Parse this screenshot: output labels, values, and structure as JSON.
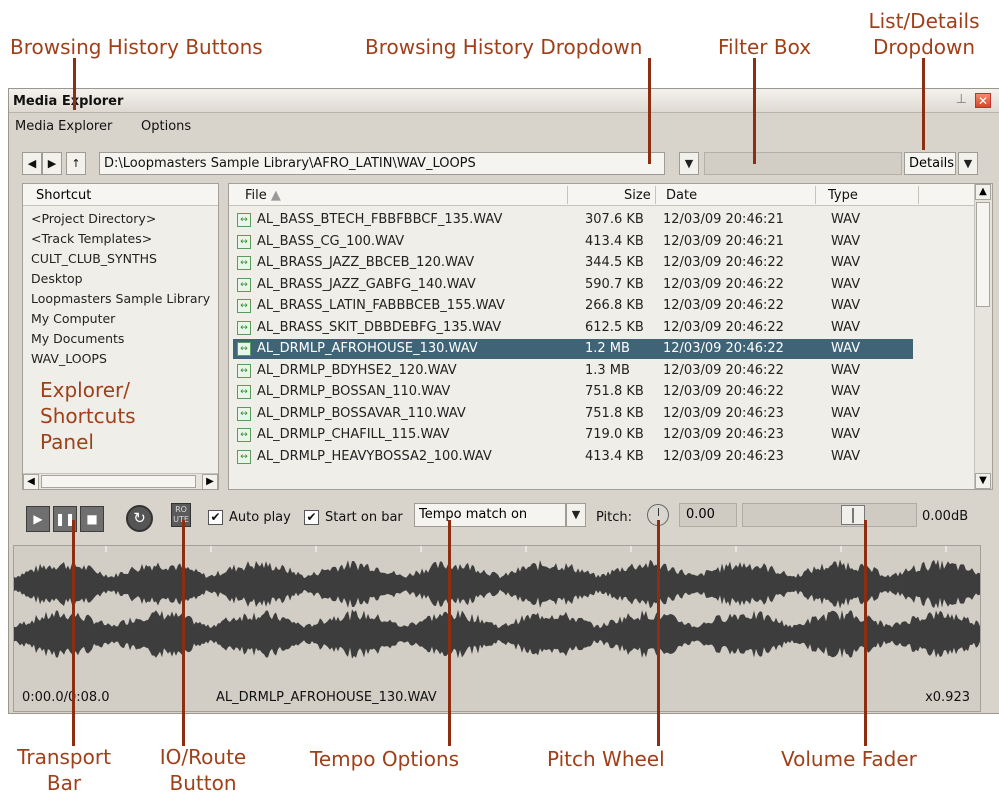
{
  "callouts": {
    "history_buttons": "Browsing History Buttons",
    "history_dropdown": "Browsing History Dropdown",
    "filter_box": "Filter Box",
    "list_details_1": "List/Details",
    "list_details_2": "Dropdown",
    "transport_1": "Transport",
    "transport_2": "Bar",
    "io_route_1": "IO/Route",
    "io_route_2": "Button",
    "tempo_options": "Tempo Options",
    "pitch_wheel": "Pitch Wheel",
    "volume_fader": "Volume Fader"
  },
  "window": {
    "title": "Media Explorer",
    "menu": [
      "Media Explorer",
      "Options"
    ]
  },
  "nav": {
    "path": "D:\\Loopmasters Sample Library\\AFRO_LATIN\\WAV_LOOPS",
    "view_mode": "Details"
  },
  "shortcuts": {
    "header": "Shortcut",
    "items": [
      "<Project Directory>",
      "<Track Templates>",
      "CULT_CLUB_SYNTHS",
      "Desktop",
      "Loopmasters Sample Library",
      "My Computer",
      "My Documents",
      "WAV_LOOPS"
    ],
    "panel_label_1": "Explorer/",
    "panel_label_2": "Shortcuts",
    "panel_label_3": "Panel"
  },
  "files": {
    "columns": [
      "File",
      "Size",
      "Date",
      "Type"
    ],
    "rows": [
      {
        "name": "AL_BASS_BTECH_FBBFBBCF_135.WAV",
        "size": "307.6 KB",
        "date": "12/03/09 20:46:21",
        "type": "WAV"
      },
      {
        "name": "AL_BASS_CG_100.WAV",
        "size": "413.4 KB",
        "date": "12/03/09 20:46:21",
        "type": "WAV"
      },
      {
        "name": "AL_BRASS_JAZZ_BBCEB_120.WAV",
        "size": "344.5 KB",
        "date": "12/03/09 20:46:22",
        "type": "WAV"
      },
      {
        "name": "AL_BRASS_JAZZ_GABFG_140.WAV",
        "size": "590.7 KB",
        "date": "12/03/09 20:46:22",
        "type": "WAV"
      },
      {
        "name": "AL_BRASS_LATIN_FABBBCEB_155.WAV",
        "size": "266.8 KB",
        "date": "12/03/09 20:46:22",
        "type": "WAV"
      },
      {
        "name": "AL_BRASS_SKIT_DBBDEBFG_135.WAV",
        "size": "612.5 KB",
        "date": "12/03/09 20:46:22",
        "type": "WAV"
      },
      {
        "name": "AL_DRMLP_AFROHOUSE_130.WAV",
        "size": "1.2 MB",
        "date": "12/03/09 20:46:22",
        "type": "WAV"
      },
      {
        "name": "AL_DRMLP_BDYHSE2_120.WAV",
        "size": "1.3 MB",
        "date": "12/03/09 20:46:22",
        "type": "WAV"
      },
      {
        "name": "AL_DRMLP_BOSSAN_110.WAV",
        "size": "751.8 KB",
        "date": "12/03/09 20:46:22",
        "type": "WAV"
      },
      {
        "name": "AL_DRMLP_BOSSAVAR_110.WAV",
        "size": "751.8 KB",
        "date": "12/03/09 20:46:23",
        "type": "WAV"
      },
      {
        "name": "AL_DRMLP_CHAFILL_115.WAV",
        "size": "719.0 KB",
        "date": "12/03/09 20:46:23",
        "type": "WAV"
      },
      {
        "name": "AL_DRMLP_HEAVYBOSSA2_100.WAV",
        "size": "413.4 KB",
        "date": "12/03/09 20:46:23",
        "type": "WAV"
      }
    ]
  },
  "controls": {
    "auto_play": "Auto play",
    "start_on_bar": "Start on bar",
    "tempo_mode": "Tempo match on",
    "pitch_label": "Pitch:",
    "pitch_value": "0.00",
    "volume_db": "0.00dB",
    "route_label_1": "RO",
    "route_label_2": "UTE",
    "volume_level": 0.67
  },
  "preview": {
    "time": "0:00.0/0:08.0",
    "filename": "AL_DRMLP_AFROHOUSE_130.WAV",
    "rate": "x0.923"
  },
  "colors": {
    "callout": "#a0401a",
    "selection": "#3e6476",
    "waveform": "#3d3d3d"
  }
}
